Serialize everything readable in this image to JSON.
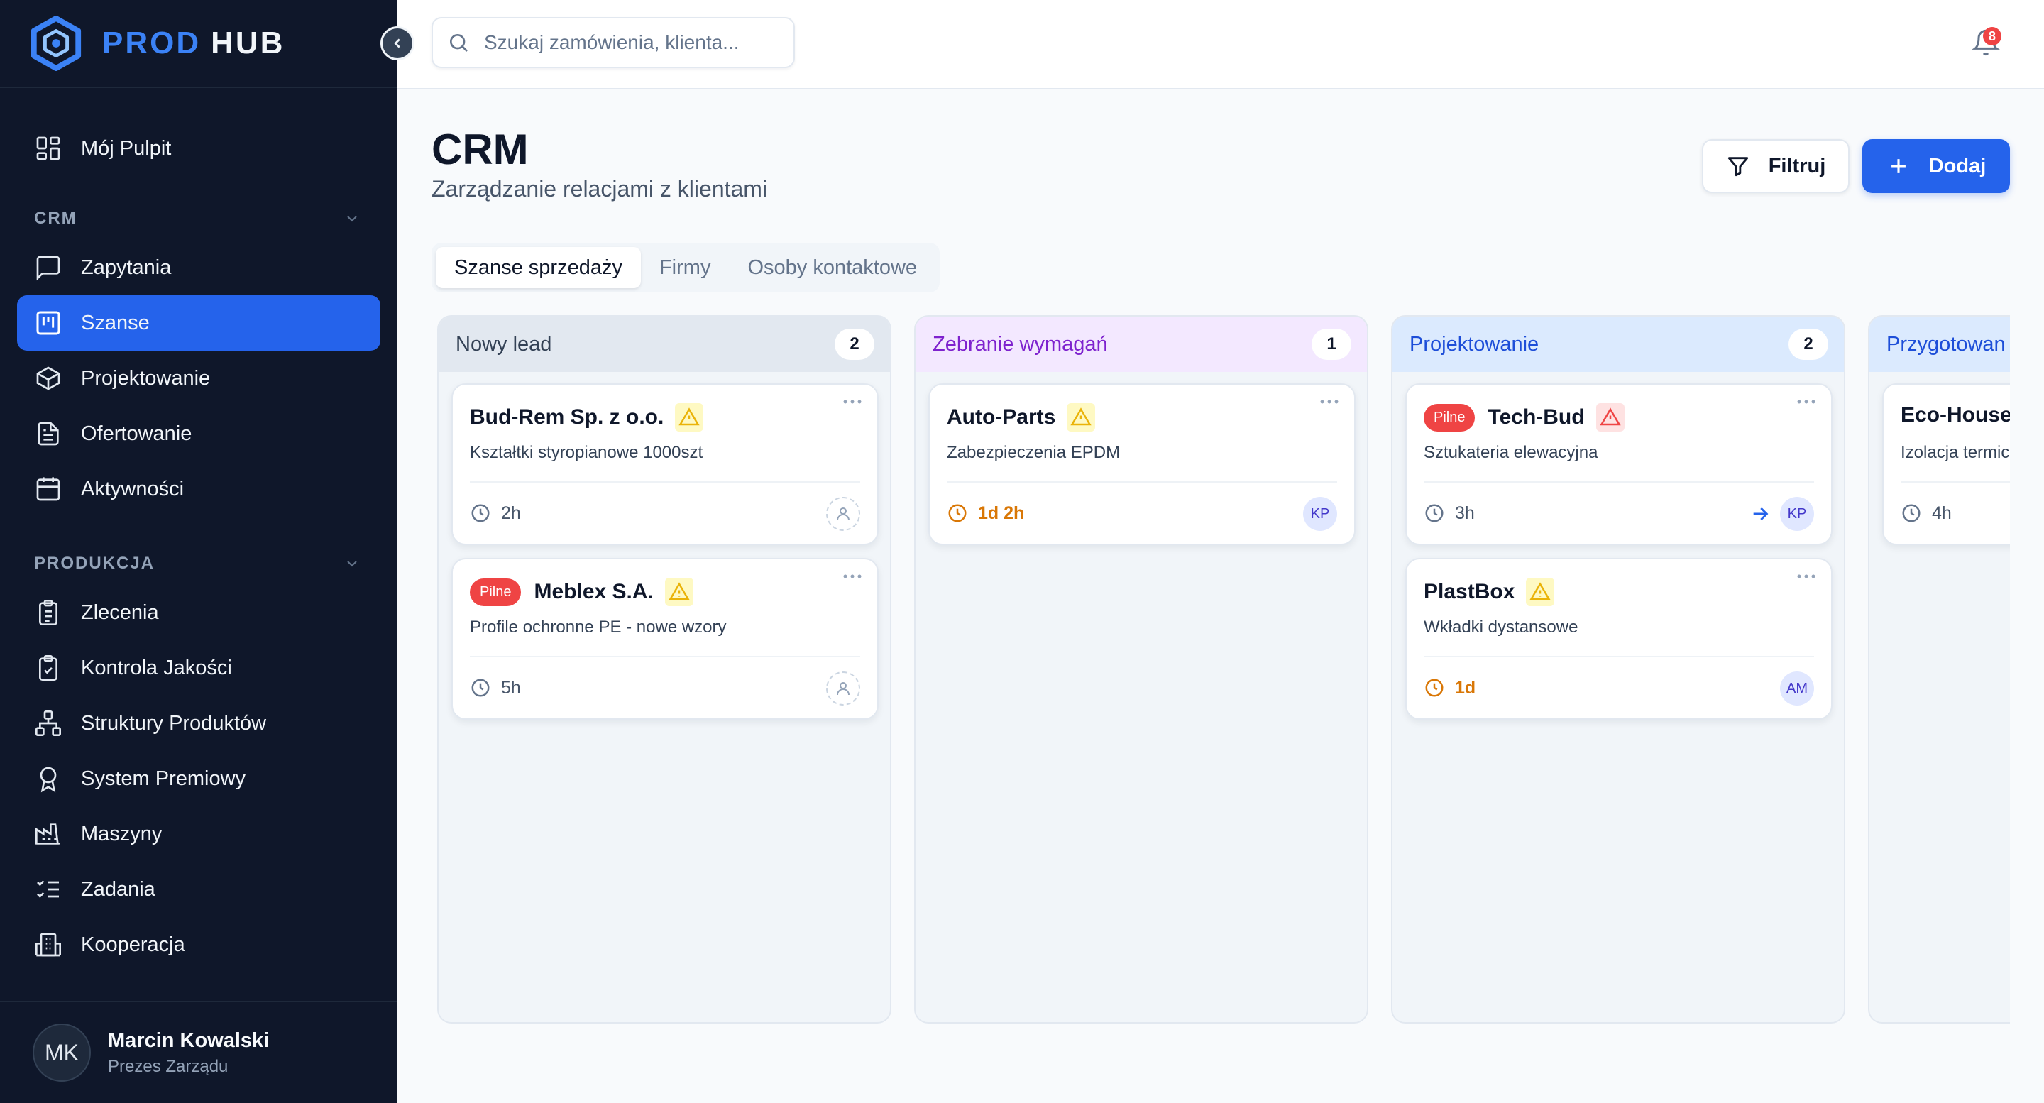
{
  "brand": {
    "part1": "PROD",
    "part2": "HUB"
  },
  "search": {
    "placeholder": "Szukaj zamówienia, klienta..."
  },
  "notifications": {
    "count": "8"
  },
  "sidebar": {
    "dashboard": "Mój Pulpit",
    "crm_section": "CRM",
    "crm_items": [
      "Zapytania",
      "Szanse",
      "Projektowanie",
      "Ofertowanie",
      "Aktywności"
    ],
    "production_section": "PRODUKCJA",
    "production_items": [
      "Zlecenia",
      "Kontrola Jakości",
      "Struktury Produktów",
      "System Premiowy",
      "Maszyny",
      "Zadania",
      "Kooperacja"
    ],
    "active_item": "Szanse"
  },
  "user": {
    "initials": "MK",
    "name": "Marcin Kowalski",
    "role": "Prezes Zarządu"
  },
  "page": {
    "title": "CRM",
    "subtitle": "Zarządzanie relacjami z klientami"
  },
  "actions": {
    "filter": "Filtruj",
    "add": "Dodaj"
  },
  "tabs": [
    "Szanse sprzedaży",
    "Firmy",
    "Osoby kontaktowe"
  ],
  "active_tab": "Szanse sprzedaży",
  "columns": [
    {
      "title": "Nowy lead",
      "count": "2",
      "color": "#334155",
      "bg": "#e2e8f0",
      "cards": [
        {
          "badge": "",
          "title": "Bud-Rem Sp. z o.o.",
          "warning": "yellow",
          "desc": "Kształtki styropianowe 1000szt",
          "time": "2h",
          "late": false,
          "assignee": ""
        },
        {
          "badge": "Pilne",
          "title": "Meblex S.A.",
          "warning": "yellow",
          "desc": "Profile ochronne PE - nowe wzory",
          "time": "5h",
          "late": false,
          "assignee": ""
        }
      ]
    },
    {
      "title": "Zebranie wymagań",
      "count": "1",
      "color": "#7e22ce",
      "bg": "#f3e8ff",
      "cards": [
        {
          "badge": "",
          "title": "Auto-Parts",
          "warning": "yellow",
          "desc": "Zabezpieczenia EPDM",
          "time": "1d 2h",
          "late": true,
          "assignee": "KP"
        }
      ]
    },
    {
      "title": "Projektowanie",
      "count": "2",
      "color": "#1d4ed8",
      "bg": "#dbeafe",
      "cards": [
        {
          "badge": "Pilne",
          "title": "Tech-Bud",
          "warning": "red",
          "desc": "Sztukateria elewacyjna",
          "time": "3h",
          "late": false,
          "assignee": "KP",
          "arrow": true
        },
        {
          "badge": "",
          "title": "PlastBox",
          "warning": "yellow",
          "desc": "Wkładki dystansowe",
          "time": "1d",
          "late": true,
          "assignee": "AM"
        }
      ]
    },
    {
      "title": "Przygotowan",
      "count": "",
      "color": "#1d4ed8",
      "bg": "#dbeafe",
      "cards": [
        {
          "badge": "",
          "title": "Eco-House",
          "warning": "",
          "desc": "Izolacja termic",
          "time": "4h",
          "late": false,
          "assignee": ""
        }
      ]
    }
  ]
}
